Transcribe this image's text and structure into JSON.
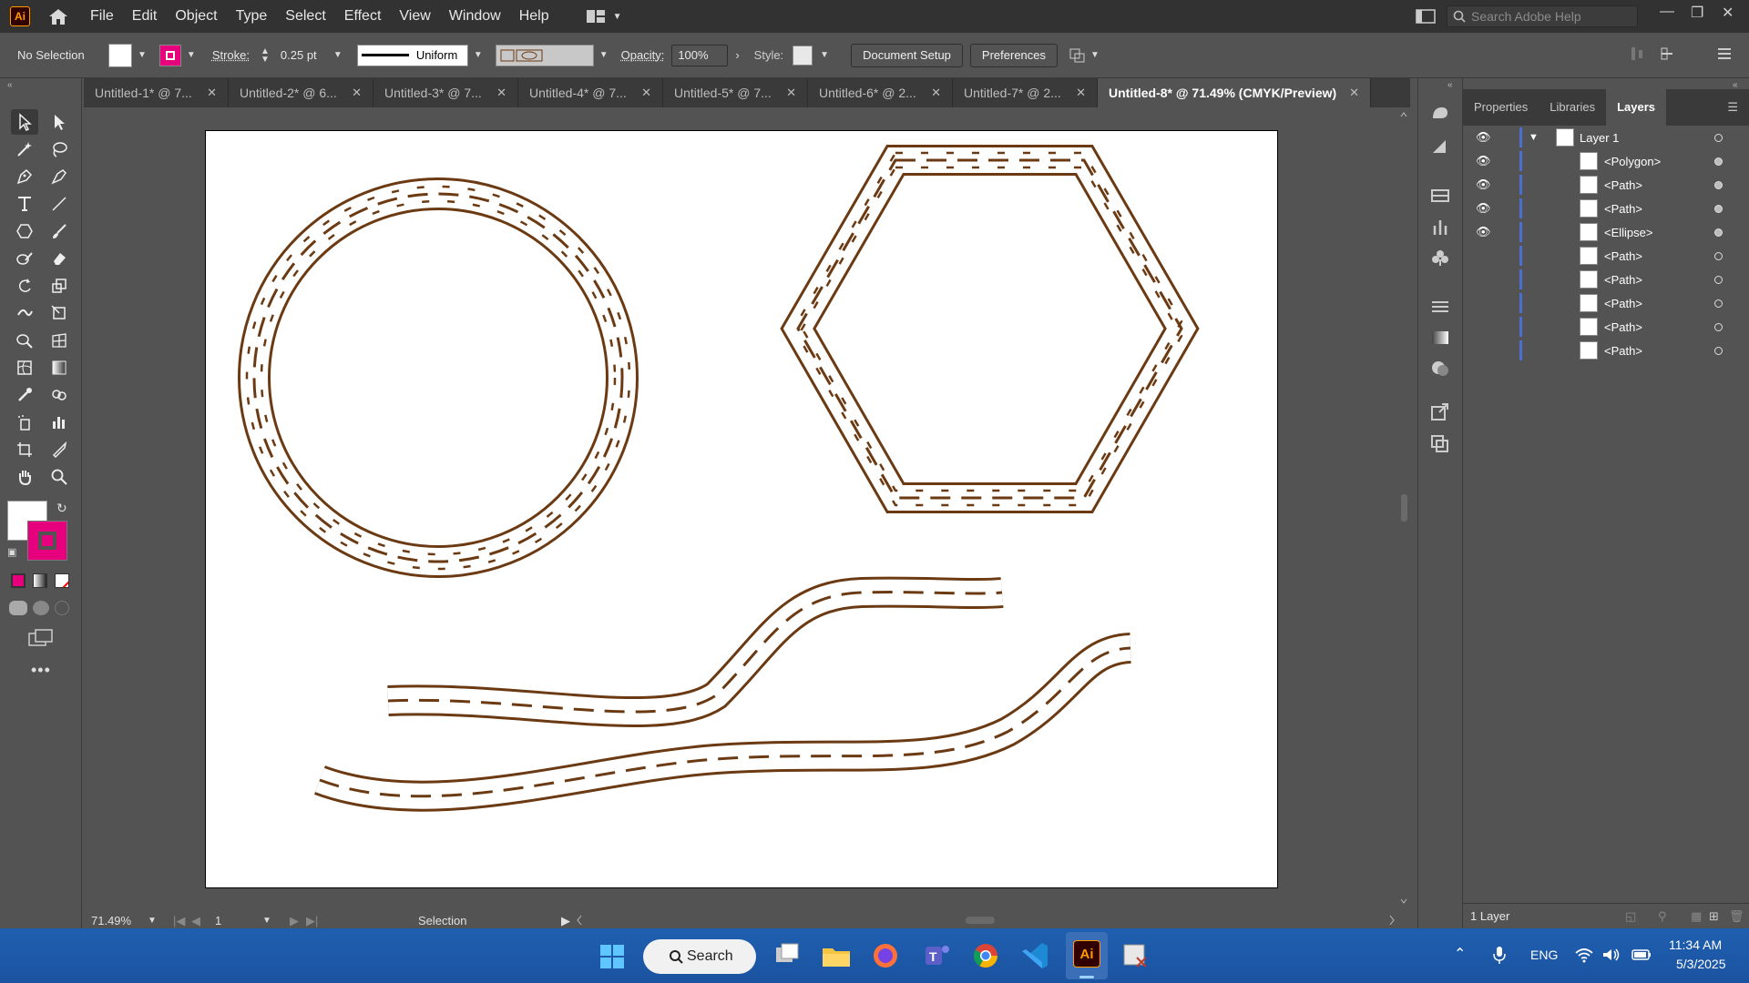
{
  "app": {
    "logo": "Ai"
  },
  "menu": [
    "File",
    "Edit",
    "Object",
    "Type",
    "Select",
    "Effect",
    "View",
    "Window",
    "Help"
  ],
  "search": {
    "placeholder": "Search Adobe Help"
  },
  "control": {
    "selection": "No Selection",
    "stroke_label": "Stroke:",
    "stroke_weight": "0.25 pt",
    "profile": "Uniform",
    "opacity_label": "Opacity:",
    "opacity": "100%",
    "style_label": "Style:",
    "document_setup": "Document Setup",
    "preferences": "Preferences",
    "fill_color": "#ffffff",
    "stroke_color": "#e6007e"
  },
  "tabs": [
    {
      "label": "Untitled-1* @ 7...",
      "active": false
    },
    {
      "label": "Untitled-2* @ 6...",
      "active": false
    },
    {
      "label": "Untitled-3* @ 7...",
      "active": false
    },
    {
      "label": "Untitled-4* @ 7...",
      "active": false
    },
    {
      "label": "Untitled-5* @ 7...",
      "active": false
    },
    {
      "label": "Untitled-6* @ 2...",
      "active": false
    },
    {
      "label": "Untitled-7* @ 2...",
      "active": false
    },
    {
      "label": "Untitled-8* @ 71.49% (CMYK/Preview)",
      "active": true
    }
  ],
  "panel": {
    "tabs": [
      "Properties",
      "Libraries",
      "Layers"
    ],
    "active_tab": "Layers",
    "layer_name": "Layer 1",
    "items": [
      "<Polygon>",
      "<Path>",
      "<Path>",
      "<Ellipse>",
      "<Path>",
      "<Path>",
      "<Path>",
      "<Path>",
      "<Path>"
    ],
    "footer": "1 Layer"
  },
  "status": {
    "zoom": "71.49%",
    "artboard": "1",
    "tool": "Selection"
  },
  "taskbar": {
    "search": "Search",
    "lang": "ENG",
    "time": "11:34 AM",
    "date": "5/3/2025"
  },
  "colors": {
    "pattern_brown": "#6b3a12",
    "accent": "#e6007e",
    "layer_blue": "#4a6fd1"
  }
}
